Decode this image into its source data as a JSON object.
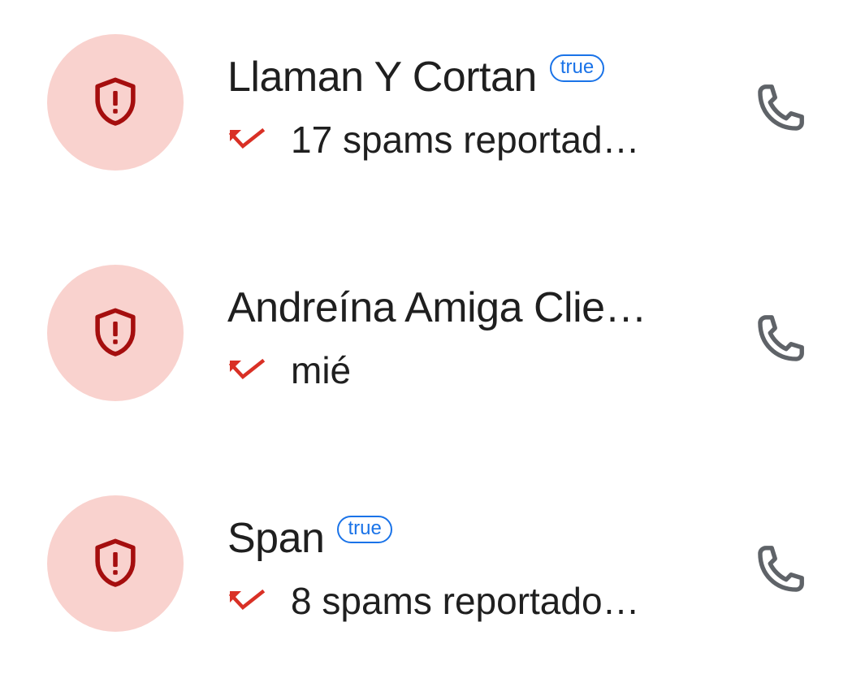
{
  "calls": [
    {
      "name": "Llaman Y Cortan",
      "badge": "true",
      "detail": "17 spams reportad…",
      "avatar_icon": "shield-alert-icon",
      "call_type_icon": "missed-call-icon",
      "action_icon": "phone-icon"
    },
    {
      "name": "Andreína Amiga Clie…",
      "badge": "",
      "detail": "mié",
      "avatar_icon": "shield-alert-icon",
      "call_type_icon": "missed-call-icon",
      "action_icon": "phone-icon"
    },
    {
      "name": "Span",
      "badge": "true",
      "detail": "8 spams reportado…",
      "avatar_icon": "shield-alert-icon",
      "call_type_icon": "missed-call-icon",
      "action_icon": "phone-icon"
    }
  ],
  "colors": {
    "avatar_background": "#f9d2ce",
    "shield": "#a50e0e",
    "missed_call": "#d93025",
    "badge": "#1a73e8",
    "phone_icon": "#5f6368",
    "text": "#1f1f1f"
  }
}
